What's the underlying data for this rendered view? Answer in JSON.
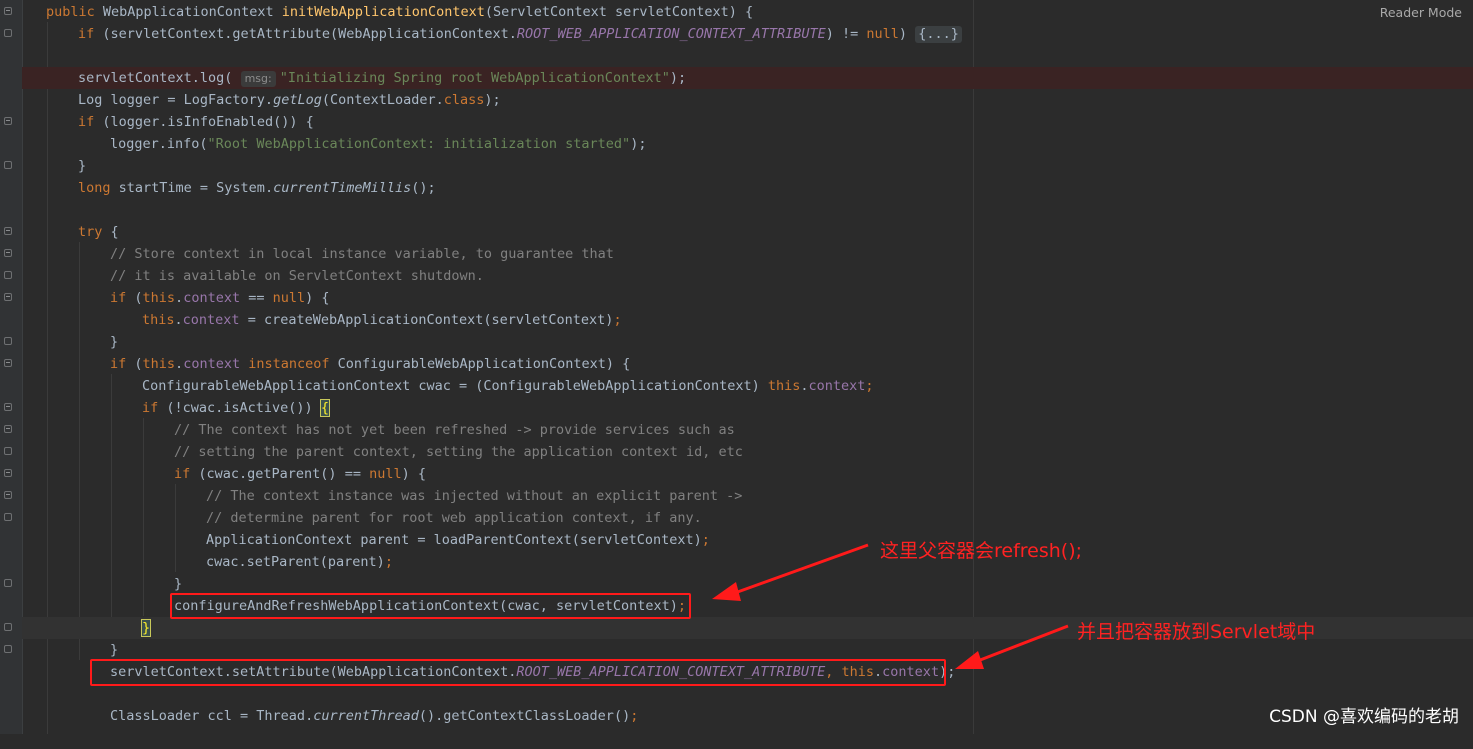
{
  "toolbar": {
    "reader_mode": "Reader Mode"
  },
  "code": {
    "l1": {
      "a": "public ",
      "b": "WebApplicationContext ",
      "c": "initWebApplicationContext",
      "d": "(ServletContext servletContext) {"
    },
    "l2": {
      "a": "if ",
      "b": "(servletContext.getAttribute(WebApplicationContext.",
      "c": "ROOT_WEB_APPLICATION_CONTEXT_ATTRIBUTE",
      "d": ") != ",
      "e": "null",
      "f": ") ",
      "g": "{...}"
    },
    "l4": {
      "a": "servletContext.log( ",
      "hint": "msg:",
      "b": "\"Initializing Spring root WebApplicationContext\"",
      "c": ");"
    },
    "l5": {
      "a": "Log logger = LogFactory.",
      "b": "getLog",
      "c": "(ContextLoader.",
      "d": "class",
      "e": ");"
    },
    "l6": {
      "a": "if ",
      "b": "(logger.isInfoEnabled()) {"
    },
    "l7": {
      "a": "logger.info(",
      "b": "\"Root WebApplicationContext: initialization started\"",
      "c": ");"
    },
    "l8": {
      "a": "}"
    },
    "l9": {
      "a": "long ",
      "b": "startTime = System.",
      "c": "currentTimeMillis",
      "d": "();"
    },
    "l11": {
      "a": "try ",
      "b": "{"
    },
    "l12": {
      "a": "// Store context in local instance variable, to guarantee that"
    },
    "l13": {
      "a": "// it is available on ServletContext shutdown."
    },
    "l14": {
      "a": "if ",
      "b": "(",
      "c": "this",
      "d": ".",
      "e": "context",
      "f": " == ",
      "g": "null",
      "h": ") {"
    },
    "l15": {
      "a": "this",
      "b": ".",
      "c": "context",
      "d": " = createWebApplicationContext(servletContext)",
      "e": ";"
    },
    "l16": {
      "a": "}"
    },
    "l17": {
      "a": "if ",
      "b": "(",
      "c": "this",
      "d": ".",
      "e": "context ",
      "f": "instanceof ",
      "g": "ConfigurableWebApplicationContext) {"
    },
    "l18": {
      "a": "ConfigurableWebApplicationContext cwac = (ConfigurableWebApplicationContext) ",
      "b": "this",
      "c": ".",
      "d": "context",
      "e": ";"
    },
    "l19": {
      "a": "if ",
      "b": "(!cwac.isActive()) ",
      "c": "{"
    },
    "l20": {
      "a": "// The context has not yet been refreshed -> provide services such as"
    },
    "l21": {
      "a": "// setting the parent context, setting the application context id, etc"
    },
    "l22": {
      "a": "if ",
      "b": "(cwac.getParent() == ",
      "c": "null",
      "d": ") {"
    },
    "l23": {
      "a": "// The context instance was injected without an explicit parent ->"
    },
    "l24": {
      "a": "// determine parent for root web application context, if any."
    },
    "l25": {
      "a": "ApplicationContext parent = loadParentContext(servletContext)",
      "b": ";"
    },
    "l26": {
      "a": "cwac.setParent(parent)",
      "b": ";"
    },
    "l27": {
      "a": "}"
    },
    "l28": {
      "a": "configureAndRefreshWebApplicationContext(cwac, servletContext)",
      "b": ";"
    },
    "l29": {
      "a": "}"
    },
    "l30": {
      "a": "}"
    },
    "l31": {
      "a": "servletContext.setAttribute(WebApplicationContext.",
      "b": "ROOT_WEB_APPLICATION_CONTEXT_ATTRIBUTE",
      "c": ", ",
      "d": "this",
      "e": ".",
      "f": "context",
      "g": ");"
    },
    "l33": {
      "a": "ClassLoader ccl = Thread.",
      "b": "currentThread",
      "c": "().getContextClassLoader()",
      "d": ";"
    }
  },
  "annotations": {
    "parent_refresh": "这里父容器会refresh();",
    "put_servlet": "并且把容器放到Servlet域中"
  },
  "watermark": "CSDN @喜欢编码的老胡",
  "colors": {
    "background": "#2b2b2b",
    "keyword": "#cc7832",
    "method_decl": "#ffc66d",
    "string": "#6a8759",
    "comment": "#808080",
    "field": "#9876aa",
    "annotation_red": "#ff1a1a"
  }
}
